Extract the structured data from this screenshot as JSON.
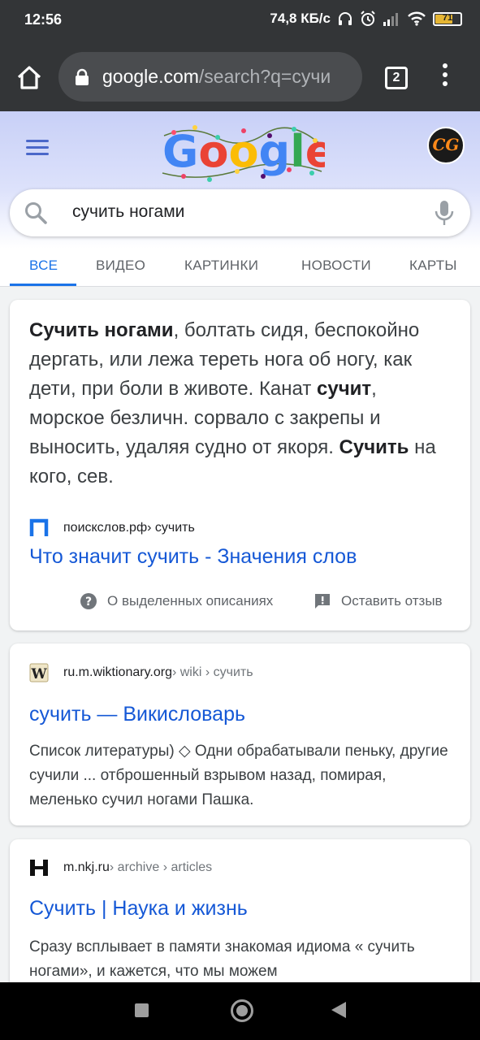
{
  "status_bar": {
    "time": "12:56",
    "speed": "74,8 КБ/с",
    "battery_level": "71",
    "battery_fraction": 0.71
  },
  "browser": {
    "url_host": "google.com",
    "url_path": "/search?q=сучи",
    "tab_count": "2",
    "icons": [
      "home-icon",
      "lock-icon",
      "tabs-icon",
      "more-vert-icon"
    ]
  },
  "google": {
    "logo_text": "Google",
    "avatar_text": "CG",
    "search_query": "сучить ногами",
    "tabs": [
      {
        "label": "ВСЕ",
        "active": true
      },
      {
        "label": "ВИДЕО",
        "active": false
      },
      {
        "label": "КАРТИНКИ",
        "active": false
      },
      {
        "label": "НОВОСТИ",
        "active": false
      },
      {
        "label": "КАРТЫ",
        "active": false
      }
    ]
  },
  "featured_snippet": {
    "text_parts": [
      {
        "bold": true,
        "text": "Сучить ногами"
      },
      {
        "bold": false,
        "text": ", болтать сидя, беспокойно дергать, или лежа тереть нога об ногу, как дети, при боли в животе. Канат "
      },
      {
        "bold": true,
        "text": "сучит"
      },
      {
        "bold": false,
        "text": ", морское безличн. сорвало с закрепы и выносить, удаляя судно от якоря. "
      },
      {
        "bold": true,
        "text": "Сучить"
      },
      {
        "bold": false,
        "text": " на кого, сев."
      }
    ],
    "source_site": "поискслов.рф",
    "source_path": " › сучить",
    "title": "Что значит сучить - Значения слов",
    "about_label": "О выделенных описаниях",
    "feedback_label": "Оставить отзыв"
  },
  "results": [
    {
      "site": "ru.m.wiktionary.org",
      "path": " › wiki › сучить",
      "favicon": "wikipedia-w-icon",
      "title": "сучить — Викисловарь",
      "description": "Список литературы) ◇ Одни обрабатывали пеньку, другие сучили ... отброшенный взрывом назад, помирая, меленько сучил ногами Пашка."
    },
    {
      "site": "m.nkj.ru",
      "path": " › archive › articles",
      "favicon": "nkj-h-icon",
      "title": "Сучить | Наука и жизнь",
      "description": "Сразу всплывает в памяти знакомая идиома « сучить ногами», и кажется, что мы можем"
    }
  ],
  "colors": {
    "link_blue": "#1a73e8",
    "result_link": "#1558d6",
    "chrome_dark": "#333537"
  }
}
